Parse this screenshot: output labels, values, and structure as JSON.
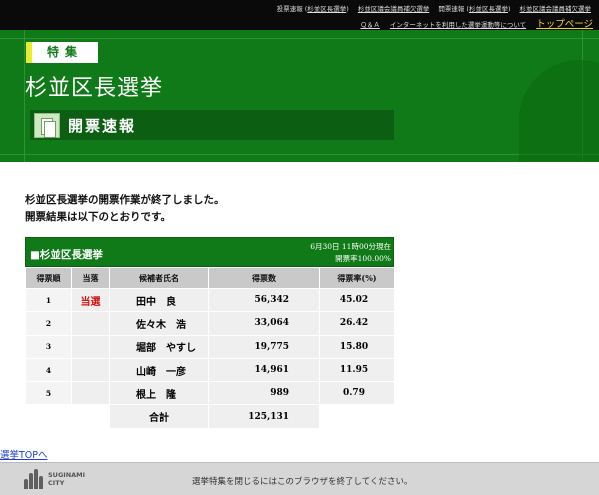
{
  "topnav": {
    "row1": [
      {
        "prefix": "投票速報 (",
        "link": "杉並区長選挙",
        "suffix": ")"
      },
      {
        "prefix": "",
        "link": "杉並区議会議員補欠選挙",
        "suffix": ""
      },
      {
        "prefix": "開票速報 (",
        "link": "杉並区長選挙",
        "suffix": ")"
      },
      {
        "prefix": "",
        "link": "杉並区議会議員補欠選挙",
        "suffix": ""
      }
    ],
    "qa": "Ｑ＆Ａ",
    "internet": "インターネットを利用した選挙運動等について",
    "top_page": "トップページ"
  },
  "header": {
    "badge": "特集",
    "title": "杉並区長選挙",
    "section": "開票速報"
  },
  "intro": {
    "line1": "杉並区長選挙の開票作業が終了しました。",
    "line2": "開票結果は以下のとおりです。"
  },
  "results": {
    "election_name": "■杉並区長選挙",
    "as_of": "6月30日 11時00分現在",
    "count_rate": "開票率100.00%",
    "columns": [
      "得票順",
      "当落",
      "候補者氏名",
      "得票数",
      "得票率(%)"
    ],
    "rows": [
      {
        "rank": "1",
        "status": "当選",
        "name": "田中　良",
        "votes": "56,342",
        "rate": "45.02"
      },
      {
        "rank": "2",
        "status": "",
        "name": "佐々木　浩",
        "votes": "33,064",
        "rate": "26.42"
      },
      {
        "rank": "3",
        "status": "",
        "name": "堀部　やすし",
        "votes": "19,775",
        "rate": "15.80"
      },
      {
        "rank": "4",
        "status": "",
        "name": "山崎　一彦",
        "votes": "14,961",
        "rate": "11.95"
      },
      {
        "rank": "5",
        "status": "",
        "name": "根上　隆",
        "votes": "989",
        "rate": "0.79"
      }
    ],
    "total_label": "合計",
    "total_votes": "125,131"
  },
  "back_link": "選挙TOPへ",
  "footer": {
    "logo_line1": "SUGINAMI",
    "logo_line2": "CITY",
    "message": "選挙特集を閉じるにはこのブラウザを終了してください。"
  },
  "colors": {
    "header_green": "#0f7a17",
    "winner_red": "#d41212",
    "top_link_yellow": "#f2d230"
  }
}
